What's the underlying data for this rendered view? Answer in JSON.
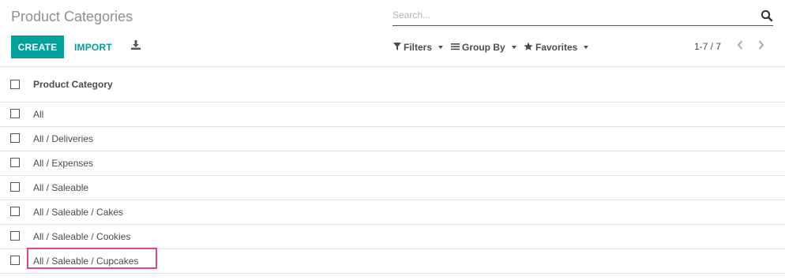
{
  "page": {
    "title": "Product Categories"
  },
  "search": {
    "placeholder": "Search..."
  },
  "toolbar": {
    "create_label": "CREATE",
    "import_label": "IMPORT"
  },
  "filters": {
    "filters_label": "Filters",
    "group_by_label": "Group By",
    "favorites_label": "Favorites"
  },
  "pager": {
    "value": "1-7 / 7"
  },
  "table": {
    "column_header": "Product Category",
    "rows": [
      "All",
      "All / Deliveries",
      "All / Expenses",
      "All / Saleable",
      "All / Saleable / Cakes",
      "All / Saleable / Cookies",
      "All / Saleable / Cupcakes"
    ]
  },
  "colors": {
    "accent": "#00a09d",
    "highlight": "#e0448a"
  }
}
